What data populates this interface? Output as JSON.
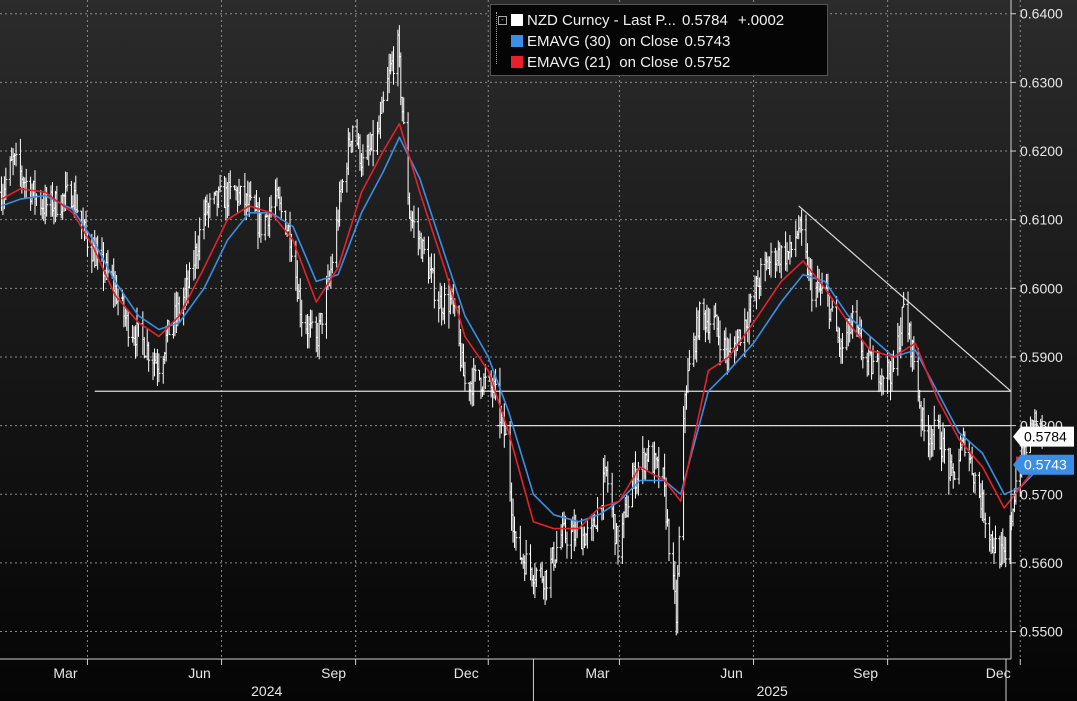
{
  "chart_data": {
    "type": "line",
    "title": "",
    "xlabel": "",
    "ylabel": "",
    "ylim": [
      0.546,
      0.642
    ],
    "yticks": [
      "0.5500",
      "0.5600",
      "0.5700",
      "0.5800",
      "0.5900",
      "0.6000",
      "0.6100",
      "0.6200",
      "0.6300",
      "0.6400"
    ],
    "x_months": [
      "Mar",
      "Jun",
      "Sep",
      "Dec",
      "Mar",
      "Jun",
      "Sep",
      "Dec"
    ],
    "x_years": [
      "2024",
      "2025"
    ],
    "grid": true,
    "legend_position": "top-center",
    "last_labels": [
      "0.5784",
      "0.5743"
    ],
    "series": [
      {
        "name": "NZD Curncy - Last P...",
        "value": "0.5784",
        "change": "+.0002",
        "color": "#ffffff",
        "kind": "price",
        "points": [
          [
            "2024-01-02",
            0.614
          ],
          [
            "2024-01-10",
            0.6185
          ],
          [
            "2024-01-20",
            0.615
          ],
          [
            "2024-01-31",
            0.612
          ],
          [
            "2024-02-10",
            0.6125
          ],
          [
            "2024-02-20",
            0.614
          ],
          [
            "2024-02-28",
            0.608
          ],
          [
            "2024-03-08",
            0.604
          ],
          [
            "2024-03-18",
            0.601
          ],
          [
            "2024-03-28",
            0.595
          ],
          [
            "2024-04-05",
            0.593
          ],
          [
            "2024-04-12",
            0.591
          ],
          [
            "2024-04-19",
            0.589
          ],
          [
            "2024-04-26",
            0.594
          ],
          [
            "2024-05-03",
            0.597
          ],
          [
            "2024-05-10",
            0.601
          ],
          [
            "2024-05-20",
            0.611
          ],
          [
            "2024-05-31",
            0.613
          ],
          [
            "2024-06-10",
            0.614
          ],
          [
            "2024-06-20",
            0.612
          ],
          [
            "2024-06-28",
            0.609
          ],
          [
            "2024-07-08",
            0.613
          ],
          [
            "2024-07-18",
            0.608
          ],
          [
            "2024-07-26",
            0.596
          ],
          [
            "2024-08-05",
            0.592
          ],
          [
            "2024-08-14",
            0.601
          ],
          [
            "2024-08-22",
            0.614
          ],
          [
            "2024-08-30",
            0.624
          ],
          [
            "2024-09-06",
            0.618
          ],
          [
            "2024-09-16",
            0.622
          ],
          [
            "2024-09-25",
            0.632
          ],
          [
            "2024-09-30",
            0.635
          ],
          [
            "2024-10-08",
            0.611
          ],
          [
            "2024-10-18",
            0.605
          ],
          [
            "2024-10-28",
            0.598
          ],
          [
            "2024-11-06",
            0.598
          ],
          [
            "2024-11-15",
            0.586
          ],
          [
            "2024-11-25",
            0.587
          ],
          [
            "2024-12-05",
            0.585
          ],
          [
            "2024-12-13",
            0.578
          ],
          [
            "2024-12-20",
            0.562
          ],
          [
            "2024-12-31",
            0.559
          ],
          [
            "2025-01-10",
            0.558
          ],
          [
            "2025-01-20",
            0.564
          ],
          [
            "2025-01-31",
            0.564
          ],
          [
            "2025-02-10",
            0.564
          ],
          [
            "2025-02-20",
            0.573
          ],
          [
            "2025-02-28",
            0.562
          ],
          [
            "2025-03-10",
            0.572
          ],
          [
            "2025-03-20",
            0.576
          ],
          [
            "2025-03-31",
            0.572
          ],
          [
            "2025-04-04",
            0.563
          ],
          [
            "2025-04-09",
            0.552
          ],
          [
            "2025-04-15",
            0.585
          ],
          [
            "2025-04-25",
            0.596
          ],
          [
            "2025-05-05",
            0.595
          ],
          [
            "2025-05-15",
            0.59
          ],
          [
            "2025-05-28",
            0.596
          ],
          [
            "2025-06-06",
            0.602
          ],
          [
            "2025-06-16",
            0.605
          ],
          [
            "2025-06-26",
            0.605
          ],
          [
            "2025-07-02",
            0.609
          ],
          [
            "2025-07-11",
            0.6
          ],
          [
            "2025-07-21",
            0.599
          ],
          [
            "2025-07-31",
            0.591
          ],
          [
            "2025-08-08",
            0.595
          ],
          [
            "2025-08-18",
            0.589
          ],
          [
            "2025-08-28",
            0.588
          ],
          [
            "2025-09-05",
            0.588
          ],
          [
            "2025-09-12",
            0.597
          ],
          [
            "2025-09-18",
            0.591
          ],
          [
            "2025-09-26",
            0.579
          ],
          [
            "2025-10-06",
            0.579
          ],
          [
            "2025-10-15",
            0.572
          ],
          [
            "2025-10-24",
            0.578
          ],
          [
            "2025-11-03",
            0.57
          ],
          [
            "2025-11-12",
            0.563
          ],
          [
            "2025-11-21",
            0.56
          ],
          [
            "2025-11-28",
            0.572
          ],
          [
            "2025-12-05",
            0.577
          ],
          [
            "2025-12-11",
            0.581
          ],
          [
            "2025-12-16",
            0.5784
          ]
        ]
      },
      {
        "name": "EMAVG (30)  on Close",
        "value": "0.5743",
        "color": "#3a8ee6",
        "kind": "ema",
        "points": [
          [
            "2024-01-02",
            0.612
          ],
          [
            "2024-01-15",
            0.613
          ],
          [
            "2024-02-01",
            0.6135
          ],
          [
            "2024-02-20",
            0.6115
          ],
          [
            "2024-03-05",
            0.607
          ],
          [
            "2024-03-20",
            0.601
          ],
          [
            "2024-04-05",
            0.596
          ],
          [
            "2024-04-19",
            0.594
          ],
          [
            "2024-05-03",
            0.595
          ],
          [
            "2024-05-20",
            0.6
          ],
          [
            "2024-06-05",
            0.607
          ],
          [
            "2024-06-20",
            0.611
          ],
          [
            "2024-07-05",
            0.611
          ],
          [
            "2024-07-20",
            0.609
          ],
          [
            "2024-08-05",
            0.601
          ],
          [
            "2024-08-20",
            0.602
          ],
          [
            "2024-09-05",
            0.611
          ],
          [
            "2024-09-20",
            0.617
          ],
          [
            "2024-10-01",
            0.622
          ],
          [
            "2024-10-15",
            0.616
          ],
          [
            "2024-11-01",
            0.605
          ],
          [
            "2024-11-15",
            0.596
          ],
          [
            "2024-12-01",
            0.59
          ],
          [
            "2024-12-15",
            0.582
          ],
          [
            "2025-01-01",
            0.57
          ],
          [
            "2025-01-15",
            0.567
          ],
          [
            "2025-02-01",
            0.566
          ],
          [
            "2025-02-15",
            0.567
          ],
          [
            "2025-03-01",
            0.569
          ],
          [
            "2025-03-15",
            0.572
          ],
          [
            "2025-04-01",
            0.572
          ],
          [
            "2025-04-12",
            0.57
          ],
          [
            "2025-05-01",
            0.585
          ],
          [
            "2025-05-15",
            0.588
          ],
          [
            "2025-06-01",
            0.592
          ],
          [
            "2025-06-20",
            0.598
          ],
          [
            "2025-07-05",
            0.602
          ],
          [
            "2025-07-20",
            0.601
          ],
          [
            "2025-08-05",
            0.596
          ],
          [
            "2025-08-20",
            0.593
          ],
          [
            "2025-09-05",
            0.59
          ],
          [
            "2025-09-20",
            0.591
          ],
          [
            "2025-10-05",
            0.585
          ],
          [
            "2025-10-20",
            0.579
          ],
          [
            "2025-11-05",
            0.576
          ],
          [
            "2025-11-20",
            0.57
          ],
          [
            "2025-12-01",
            0.571
          ],
          [
            "2025-12-16",
            0.5743
          ]
        ]
      },
      {
        "name": "EMAVG (21)  on Close",
        "value": "0.5752",
        "color": "#e8202a",
        "kind": "ema",
        "points": [
          [
            "2024-01-02",
            0.613
          ],
          [
            "2024-01-15",
            0.6145
          ],
          [
            "2024-02-01",
            0.614
          ],
          [
            "2024-02-20",
            0.611
          ],
          [
            "2024-03-05",
            0.606
          ],
          [
            "2024-03-20",
            0.599
          ],
          [
            "2024-04-05",
            0.595
          ],
          [
            "2024-04-19",
            0.593
          ],
          [
            "2024-05-03",
            0.596
          ],
          [
            "2024-05-20",
            0.603
          ],
          [
            "2024-06-05",
            0.61
          ],
          [
            "2024-06-20",
            0.612
          ],
          [
            "2024-07-05",
            0.611
          ],
          [
            "2024-07-20",
            0.607
          ],
          [
            "2024-08-05",
            0.598
          ],
          [
            "2024-08-20",
            0.603
          ],
          [
            "2024-09-05",
            0.614
          ],
          [
            "2024-09-20",
            0.62
          ],
          [
            "2024-10-01",
            0.624
          ],
          [
            "2024-10-15",
            0.614
          ],
          [
            "2024-11-01",
            0.603
          ],
          [
            "2024-11-15",
            0.593
          ],
          [
            "2024-12-01",
            0.588
          ],
          [
            "2024-12-15",
            0.579
          ],
          [
            "2025-01-01",
            0.566
          ],
          [
            "2025-01-15",
            0.565
          ],
          [
            "2025-02-01",
            0.565
          ],
          [
            "2025-02-15",
            0.568
          ],
          [
            "2025-03-01",
            0.569
          ],
          [
            "2025-03-15",
            0.574
          ],
          [
            "2025-04-01",
            0.572
          ],
          [
            "2025-04-12",
            0.569
          ],
          [
            "2025-05-01",
            0.588
          ],
          [
            "2025-05-15",
            0.59
          ],
          [
            "2025-06-01",
            0.595
          ],
          [
            "2025-06-20",
            0.601
          ],
          [
            "2025-07-05",
            0.604
          ],
          [
            "2025-07-20",
            0.6
          ],
          [
            "2025-08-05",
            0.595
          ],
          [
            "2025-08-20",
            0.591
          ],
          [
            "2025-09-05",
            0.59
          ],
          [
            "2025-09-20",
            0.592
          ],
          [
            "2025-10-05",
            0.584
          ],
          [
            "2025-10-20",
            0.578
          ],
          [
            "2025-11-05",
            0.574
          ],
          [
            "2025-11-20",
            0.568
          ],
          [
            "2025-12-01",
            0.571
          ],
          [
            "2025-12-16",
            0.5752
          ]
        ]
      }
    ],
    "annotations": [
      {
        "kind": "horizontal-line",
        "y": 0.585,
        "x_start": "2024-03-06",
        "x_end": "2025-12-31"
      },
      {
        "kind": "horizontal-line",
        "y": 0.58,
        "x_start": "2024-12-07",
        "x_end": "2025-12-31"
      },
      {
        "kind": "trendline",
        "x1": "2025-07-02",
        "y1": 0.612,
        "x2": "2025-12-31",
        "y2": 0.585
      }
    ]
  }
}
